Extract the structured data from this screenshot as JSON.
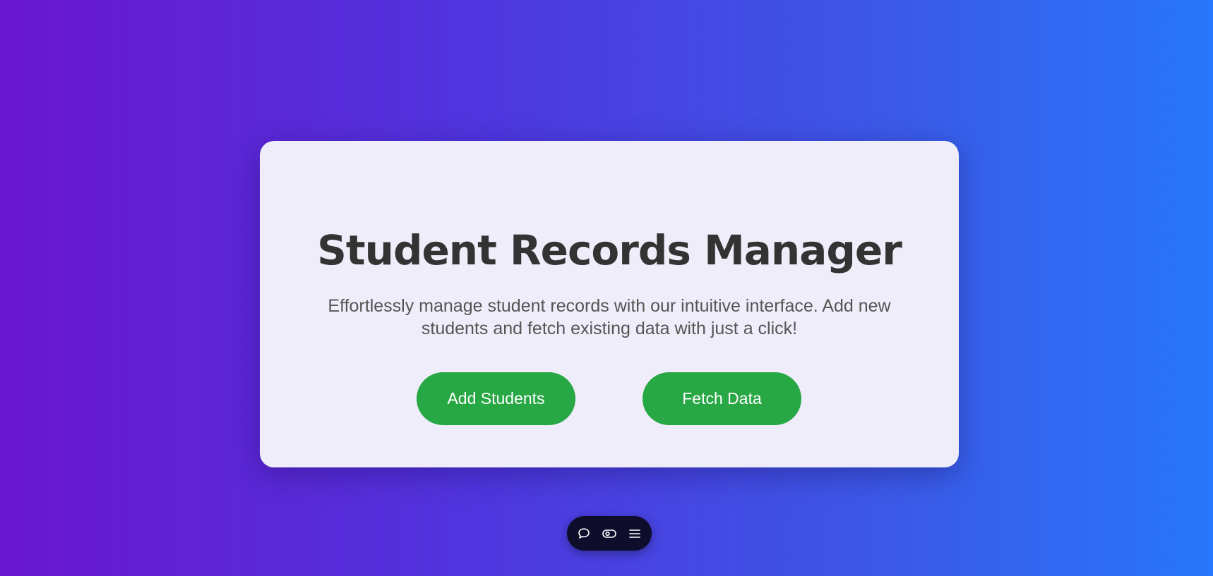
{
  "card": {
    "title": "Student Records Manager",
    "subtitle": "Effortlessly manage student records with our intuitive interface. Add new students and fetch existing data with just a click!",
    "buttons": {
      "add_label": "Add Students",
      "fetch_label": "Fetch Data"
    }
  },
  "toolbar": {
    "icons": [
      "chat-bubble-icon",
      "eye-toggle-icon",
      "menu-icon"
    ]
  },
  "colors": {
    "gradient_start": "#6a16cf",
    "gradient_end": "#2776fb",
    "card_background": "#efedf9",
    "button_green": "#28a745",
    "title_text": "#333333",
    "toolbar_background": "#0e0e2c"
  }
}
